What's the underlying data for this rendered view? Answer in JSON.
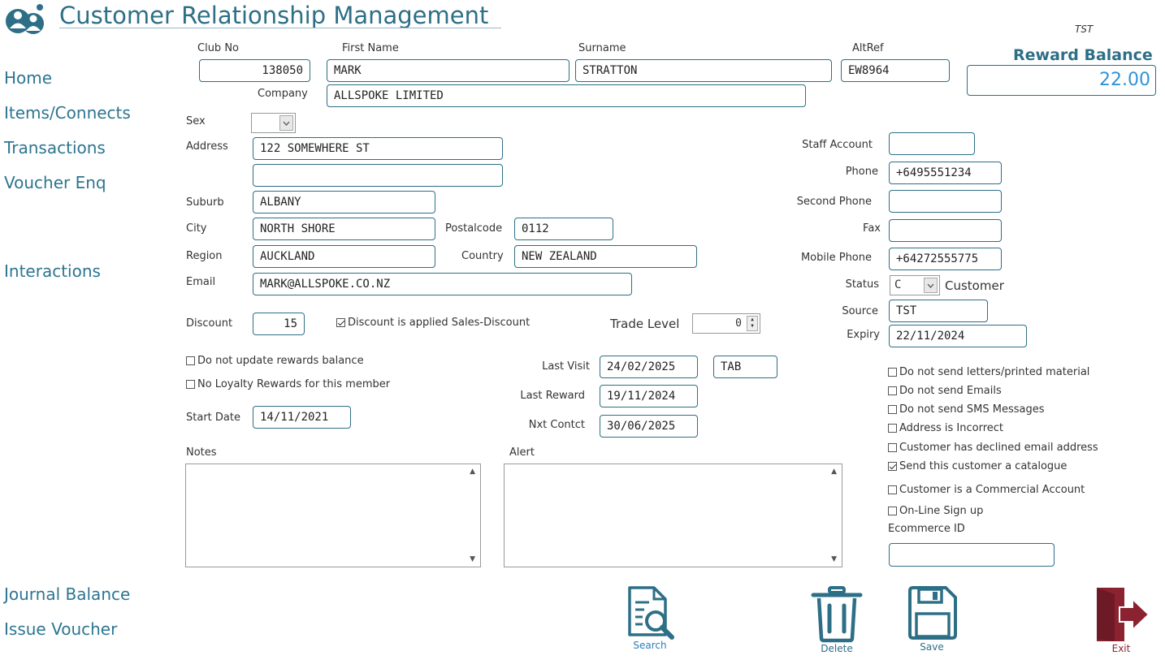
{
  "header": {
    "title": "Customer Relationship Management",
    "env_code": "TST"
  },
  "nav": {
    "home": "Home",
    "items": "Items/Connects",
    "transactions": "Transactions",
    "voucher_enq": "Voucher Enq",
    "interactions": "Interactions",
    "journal_balance": "Journal Balance",
    "issue_voucher": "Issue Voucher"
  },
  "labels": {
    "club_no": "Club No",
    "first_name": "First Name",
    "surname": "Surname",
    "altref": "AltRef",
    "company": "Company",
    "sex": "Sex",
    "address": "Address",
    "suburb": "Suburb",
    "city": "City",
    "postalcode": "Postalcode",
    "region": "Region",
    "country": "Country",
    "email": "Email",
    "discount": "Discount",
    "trade_level": "Trade Level",
    "start_date": "Start Date",
    "last_visit": "Last Visit",
    "last_reward": "Last Reward",
    "nxt_contct": "Nxt Contct",
    "notes": "Notes",
    "alert": "Alert",
    "staff_account": "Staff Account",
    "phone": "Phone",
    "second_phone": "Second Phone",
    "fax": "Fax",
    "mobile_phone": "Mobile Phone",
    "status": "Status",
    "source": "Source",
    "expiry": "Expiry",
    "ecommerce_id": "Ecommerce ID",
    "reward_balance": "Reward Balance"
  },
  "values": {
    "club_no": "138050",
    "first_name": "MARK",
    "surname": "STRATTON",
    "altref": "EW8964",
    "company": "ALLSPOKE LIMITED",
    "sex": "",
    "address1": "122 SOMEWHERE ST",
    "address2": "",
    "suburb": "ALBANY",
    "city": "NORTH SHORE",
    "postalcode": "0112",
    "region": "AUCKLAND",
    "country": "NEW ZEALAND",
    "email": "MARK@ALLSPOKE.CO.NZ",
    "discount": "15",
    "trade_level": "0",
    "start_date": "14/11/2021",
    "last_visit": "24/02/2025",
    "last_visit_code": "TAB",
    "last_reward": "19/11/2024",
    "nxt_contct": "30/06/2025",
    "staff_account": "",
    "phone": "+6495551234",
    "second_phone": "",
    "fax": "",
    "mobile_phone": "+64272555775",
    "status_code": "C",
    "status_text": "Customer",
    "source": "TST",
    "expiry": "22/11/2024",
    "ecommerce_id": "",
    "reward_balance": "22.00"
  },
  "checks": {
    "discount_applied": {
      "label": "Discount is applied Sales-Discount",
      "checked": true
    },
    "no_update_rewards": {
      "label": "Do not update rewards balance",
      "checked": false
    },
    "no_loyalty": {
      "label": "No Loyalty Rewards for this member",
      "checked": false
    },
    "no_letters": {
      "label": "Do not send letters/printed material",
      "checked": false
    },
    "no_emails": {
      "label": "Do not send Emails",
      "checked": false
    },
    "no_sms": {
      "label": "Do not send SMS Messages",
      "checked": false
    },
    "address_incorrect": {
      "label": "Address is Incorrect",
      "checked": false
    },
    "declined_email": {
      "label": "Customer has declined email address",
      "checked": false
    },
    "send_catalogue": {
      "label": "Send this customer a catalogue",
      "checked": true
    },
    "commercial": {
      "label": "Customer is a Commercial Account",
      "checked": false
    },
    "online_signup": {
      "label": "On-Line Sign up",
      "checked": false
    }
  },
  "toolbar": {
    "search": "Search",
    "delete": "Delete",
    "save": "Save",
    "exit": "Exit"
  },
  "colors": {
    "accent": "#2d6f86",
    "reward": "#2f93d8",
    "exit": "#8b2230"
  }
}
